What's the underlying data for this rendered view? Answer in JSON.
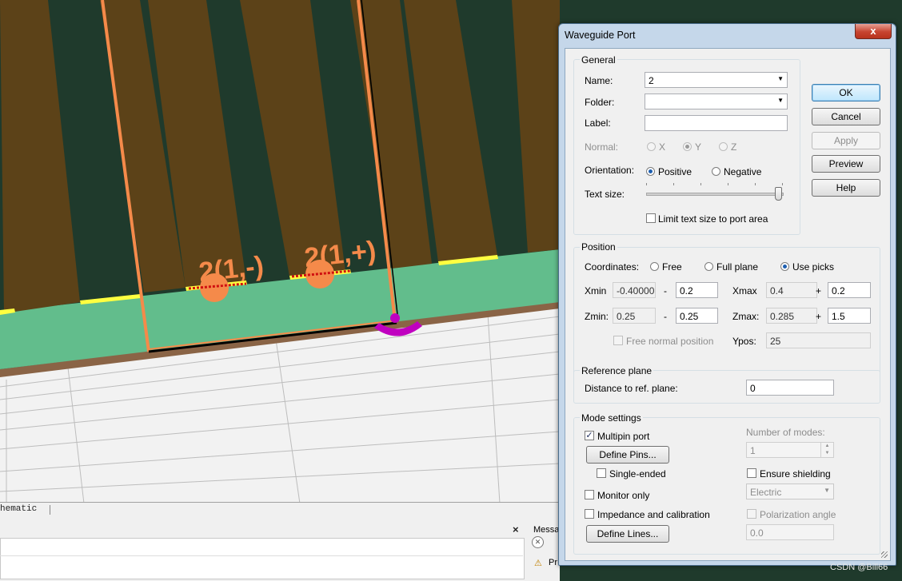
{
  "viewport": {
    "port_label_neg": "2(1,-)",
    "port_label_pos": "2(1,+)"
  },
  "bottom_panel": {
    "schematic_tab": "hematic",
    "close_glyph": "×",
    "messages_label": "Messa",
    "message_row_text": "Pr"
  },
  "dialog": {
    "title": "Waveguide Port",
    "close_glyph": "x",
    "general": {
      "title": "General",
      "name_label": "Name:",
      "name_value": "2",
      "folder_label": "Folder:",
      "folder_value": "",
      "label_label": "Label:",
      "label_value": "",
      "normal_label": "Normal:",
      "normal_options": [
        "X",
        "Y",
        "Z"
      ],
      "normal_selected": "Y",
      "orientation_label": "Orientation:",
      "orientation_options": [
        "Positive",
        "Negative"
      ],
      "orientation_selected": "Positive",
      "text_size_label": "Text size:",
      "text_size_level": 1.0,
      "limit_text_label": "Limit text size to port area",
      "limit_text_checked": false
    },
    "position": {
      "title": "Position",
      "coordinates_label": "Coordinates:",
      "coordinate_options": [
        "Free",
        "Full plane",
        "Use picks"
      ],
      "coordinate_selected": "Use picks",
      "xmin_label": "Xmin",
      "xmin_value": "-0.40000",
      "xmin_sep": "-",
      "xmin_offset": "0.2",
      "xmax_label": "Xmax",
      "xmax_value": "0.4",
      "xmax_sep": "+",
      "xmax_offset": "0.2",
      "zmin_label": "Zmin:",
      "zmin_value": "0.25",
      "zmin_sep": "-",
      "zmin_offset": "0.25",
      "zmax_label": "Zmax:",
      "zmax_value": "0.285",
      "zmax_sep": "+",
      "zmax_offset": "1.5",
      "free_normal_label": "Free normal position",
      "free_normal_checked": false,
      "ypos_label": "Ypos:",
      "ypos_value": "25"
    },
    "reference_plane": {
      "title": "Reference plane",
      "distance_label": "Distance to ref. plane:",
      "distance_value": "0"
    },
    "mode_settings": {
      "title": "Mode settings",
      "multipin_label": "Multipin port",
      "multipin_checked": true,
      "define_pins_label": "Define Pins...",
      "single_ended_label": "Single-ended",
      "single_ended_checked": false,
      "monitor_only_label": "Monitor only",
      "monitor_only_checked": false,
      "impedance_label": "Impedance and calibration",
      "impedance_checked": false,
      "define_lines_label": "Define Lines...",
      "num_modes_label": "Number of modes:",
      "num_modes_value": "1",
      "ensure_shielding_label": "Ensure shielding",
      "ensure_shielding_checked": false,
      "shielding_type": "Electric",
      "polarization_label": "Polarization angle",
      "polarization_checked": false,
      "polarization_value": "0.0"
    },
    "buttons": {
      "ok": "OK",
      "cancel": "Cancel",
      "apply": "Apply",
      "preview": "Preview",
      "help": "Help"
    }
  },
  "watermark": "CSDN @Bill66",
  "colors": {
    "background_dark": "#1f3a2c",
    "strip_brown": "#5c4218",
    "substrate_green": "#62bd8c",
    "port_orange": "#f58a4a",
    "highlight_magenta": "#c000c0",
    "dialog_frame": "#c5d7ea"
  }
}
